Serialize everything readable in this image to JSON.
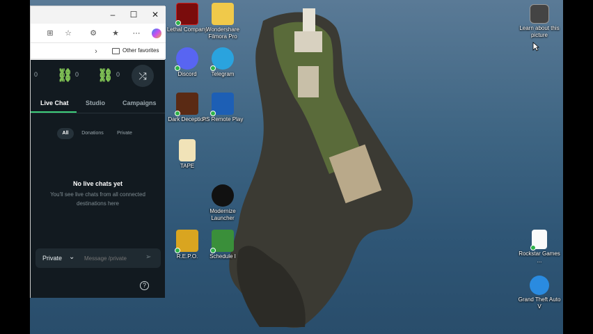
{
  "browser": {
    "favorites_label": "Other favorites",
    "window_controls": {
      "minimize": "–",
      "maximize": "☐",
      "close": "✕"
    }
  },
  "app": {
    "destinations": [
      {
        "count": "0"
      },
      {
        "count": "0"
      },
      {
        "count": "0"
      }
    ],
    "tabs": [
      "Live Chat",
      "Studio",
      "Campaigns"
    ],
    "filters": [
      "All",
      "Donations",
      "Private"
    ],
    "empty_title": "No live chats yet",
    "empty_subtitle": "You'll see live chats from all connected destinations here",
    "composer": {
      "mode": "Private",
      "placeholder": "Message /private"
    },
    "help_icon": "?"
  },
  "desktop": {
    "icons": [
      {
        "label": "Lethal Company"
      },
      {
        "label": "Wondershare Filmora Pro"
      },
      {
        "label": "Discord"
      },
      {
        "label": "Telegram"
      },
      {
        "label": "Dark Deception"
      },
      {
        "label": "PS Remote Play"
      },
      {
        "label": "TAPE"
      },
      {
        "label": "Modernize Launcher"
      },
      {
        "label": "R.E.P.O."
      },
      {
        "label": "Schedule I"
      },
      {
        "label": "Learn about this picture"
      },
      {
        "label": "Rockstar Games ..."
      },
      {
        "label": "Grand Theft Auto V"
      }
    ]
  },
  "colors": {
    "accent": "#3fd07c",
    "chain": "#8bd35a",
    "app_bg": "#121a20"
  }
}
